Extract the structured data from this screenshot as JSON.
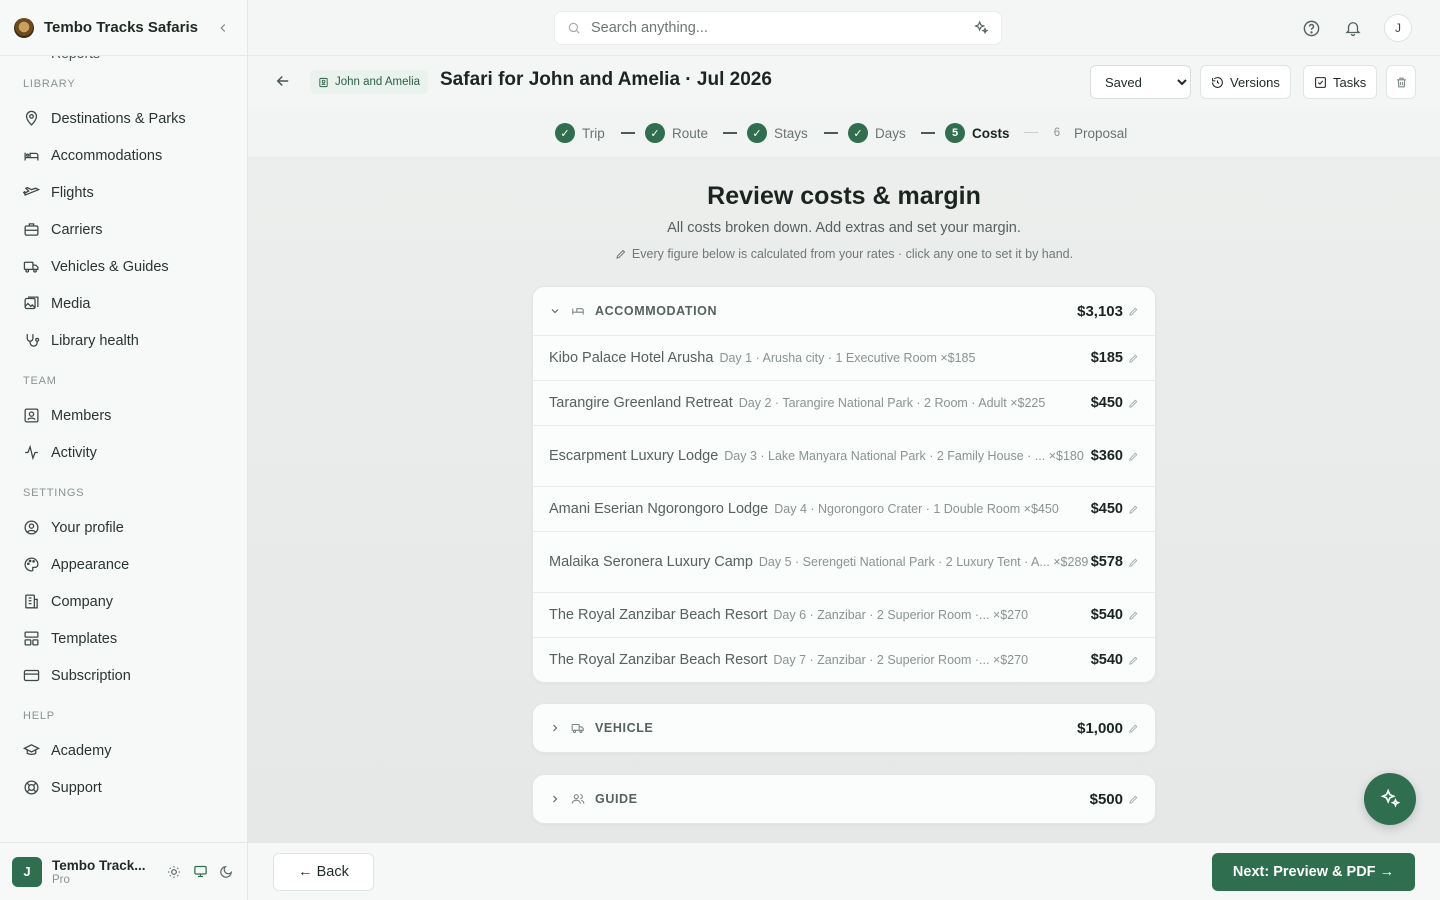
{
  "brand": {
    "name": "Tembo Tracks Safaris"
  },
  "sidebar": {
    "cut_item": "Reports",
    "sections": [
      {
        "title": "LIBRARY",
        "items": [
          {
            "label": "Destinations & Parks",
            "icon": "map-pin-icon"
          },
          {
            "label": "Accommodations",
            "icon": "bed-icon"
          },
          {
            "label": "Flights",
            "icon": "plane-icon"
          },
          {
            "label": "Carriers",
            "icon": "briefcase-icon"
          },
          {
            "label": "Vehicles & Guides",
            "icon": "truck-icon"
          },
          {
            "label": "Media",
            "icon": "image-icon"
          },
          {
            "label": "Library health",
            "icon": "stethoscope-icon"
          }
        ]
      },
      {
        "title": "TEAM",
        "items": [
          {
            "label": "Members",
            "icon": "user-square-icon"
          },
          {
            "label": "Activity",
            "icon": "activity-icon"
          }
        ]
      },
      {
        "title": "SETTINGS",
        "items": [
          {
            "label": "Your profile",
            "icon": "user-circle-icon"
          },
          {
            "label": "Appearance",
            "icon": "palette-icon"
          },
          {
            "label": "Company",
            "icon": "building-icon"
          },
          {
            "label": "Templates",
            "icon": "layout-icon"
          },
          {
            "label": "Subscription",
            "icon": "credit-card-icon"
          }
        ]
      },
      {
        "title": "HELP",
        "items": [
          {
            "label": "Academy",
            "icon": "graduation-cap-icon"
          },
          {
            "label": "Support",
            "icon": "life-buoy-icon"
          }
        ]
      }
    ],
    "footer": {
      "avatar": "J",
      "name": "Tembo Track...",
      "plan": "Pro"
    }
  },
  "search": {
    "placeholder": "Search anything..."
  },
  "topbar": {
    "user_initial": "J"
  },
  "header": {
    "client_chip": "John and Amelia",
    "title": "Safari for John and Amelia · Jul 2026",
    "status_options": [
      "Saved"
    ],
    "status_value": "Saved",
    "versions_label": "Versions",
    "tasks_label": "Tasks"
  },
  "stepper": {
    "steps": [
      {
        "label": "Trip",
        "state": "done"
      },
      {
        "label": "Route",
        "state": "done"
      },
      {
        "label": "Stays",
        "state": "done"
      },
      {
        "label": "Days",
        "state": "done"
      },
      {
        "label": "Costs",
        "state": "active",
        "number": "5"
      },
      {
        "label": "Proposal",
        "state": "upcoming",
        "number": "6"
      }
    ]
  },
  "main": {
    "title": "Review costs & margin",
    "subtitle": "All costs broken down. Add extras and set your margin.",
    "hint": "Every figure below is calculated from your rates · click any one to set it by hand."
  },
  "costs": {
    "accommodation": {
      "label": "ACCOMMODATION",
      "total": "$3,103",
      "expanded": true,
      "rows": [
        {
          "name": "Kibo Palace Hotel Arusha",
          "meta": "Day 1 · Arusha city · 1 Executive Room ×$185",
          "amount": "$185"
        },
        {
          "name": "Tarangire Greenland Retreat",
          "meta": "Day 2 · Tarangire National Park · 2 Room · Adult ×$225",
          "amount": "$450"
        },
        {
          "name": "Escarpment Luxury Lodge",
          "meta": "Day 3 · Lake Manyara National Park · 2 Family House · ... ×$180",
          "amount": "$360"
        },
        {
          "name": "Amani Eserian Ngorongoro Lodge",
          "meta": "Day 4 · Ngorongoro Crater · 1 Double Room ×$450",
          "amount": "$450"
        },
        {
          "name": "Malaika Seronera Luxury Camp",
          "meta": "Day 5 · Serengeti National Park · 2 Luxury Tent · A... ×$289",
          "amount": "$578"
        },
        {
          "name": "The Royal Zanzibar Beach Resort",
          "meta": "Day 6 · Zanzibar · 2 Superior Room ·... ×$270",
          "amount": "$540"
        },
        {
          "name": "The Royal Zanzibar Beach Resort",
          "meta": "Day 7 · Zanzibar · 2 Superior Room ·... ×$270",
          "amount": "$540"
        }
      ]
    },
    "vehicle": {
      "label": "VEHICLE",
      "total": "$1,000",
      "expanded": false
    },
    "guide": {
      "label": "GUIDE",
      "total": "$500",
      "expanded": false
    }
  },
  "footer": {
    "back_label": "← Back",
    "next_label": "Next: Preview & PDF →"
  },
  "colors": {
    "accent": "#2f6e4e"
  }
}
